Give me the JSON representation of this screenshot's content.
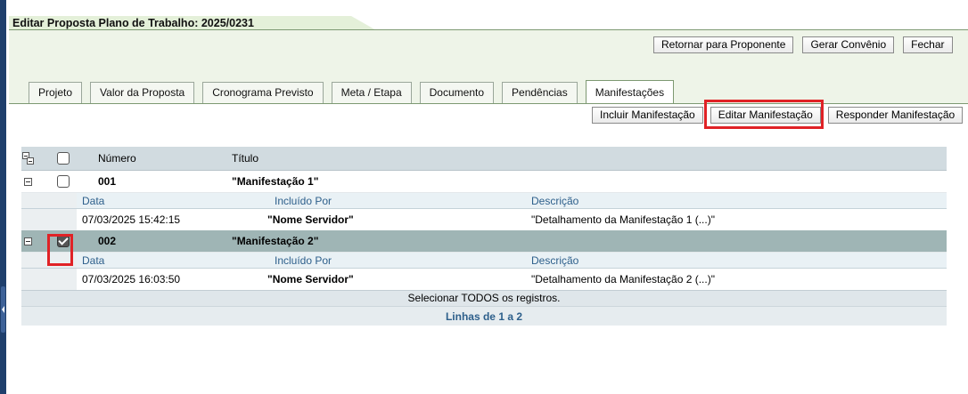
{
  "header": {
    "title": "Editar Proposta Plano de Trabalho: 2025/0231",
    "buttons": {
      "retornar": "Retornar para Proponente",
      "gerar": "Gerar Convênio",
      "fechar": "Fechar"
    }
  },
  "tabs": [
    {
      "label": "Projeto"
    },
    {
      "label": "Valor da Proposta"
    },
    {
      "label": "Cronograma Previsto"
    },
    {
      "label": "Meta / Etapa"
    },
    {
      "label": "Documento"
    },
    {
      "label": "Pendências"
    },
    {
      "label": "Manifestações",
      "active": true
    }
  ],
  "actions": {
    "incluir": "Incluir Manifestação",
    "editar": "Editar Manifestação",
    "responder": "Responder Manifestação"
  },
  "grid": {
    "columns": {
      "numero": "Número",
      "titulo": "Título"
    },
    "detail_columns": {
      "data": "Data",
      "incluido_por": "Incluído Por",
      "descricao": "Descrição"
    },
    "rows": [
      {
        "numero": "001",
        "titulo": "\"Manifestação 1\"",
        "checked": false,
        "data": "07/03/2025 15:42:15",
        "incluido_por": "\"Nome Servidor\"",
        "descricao": "\"Detalhamento da Manifestação 1 (...)\""
      },
      {
        "numero": "002",
        "titulo": "\"Manifestação 2\"",
        "checked": true,
        "data": "07/03/2025 16:03:50",
        "incluido_por": "\"Nome Servidor\"",
        "descricao": "\"Detalhamento da Manifestação 2 (...)\""
      }
    ],
    "select_all": "Selecionar TODOS os registros.",
    "pager": "Linhas de 1 a 2"
  },
  "colors": {
    "header_bg": "#eef4e8",
    "grid_header_bg": "#d1dbe0",
    "selected_row_bg": "#9fb5b5",
    "highlight": "#e02226",
    "link_blue": "#2d5f8b"
  },
  "icons": {
    "expand_all": "expand-collapse-all-icon",
    "collapse_row": "collapse-row-icon",
    "checkbox": "checkbox-icon",
    "sidebar_toggle": "sidebar-toggle-icon"
  }
}
